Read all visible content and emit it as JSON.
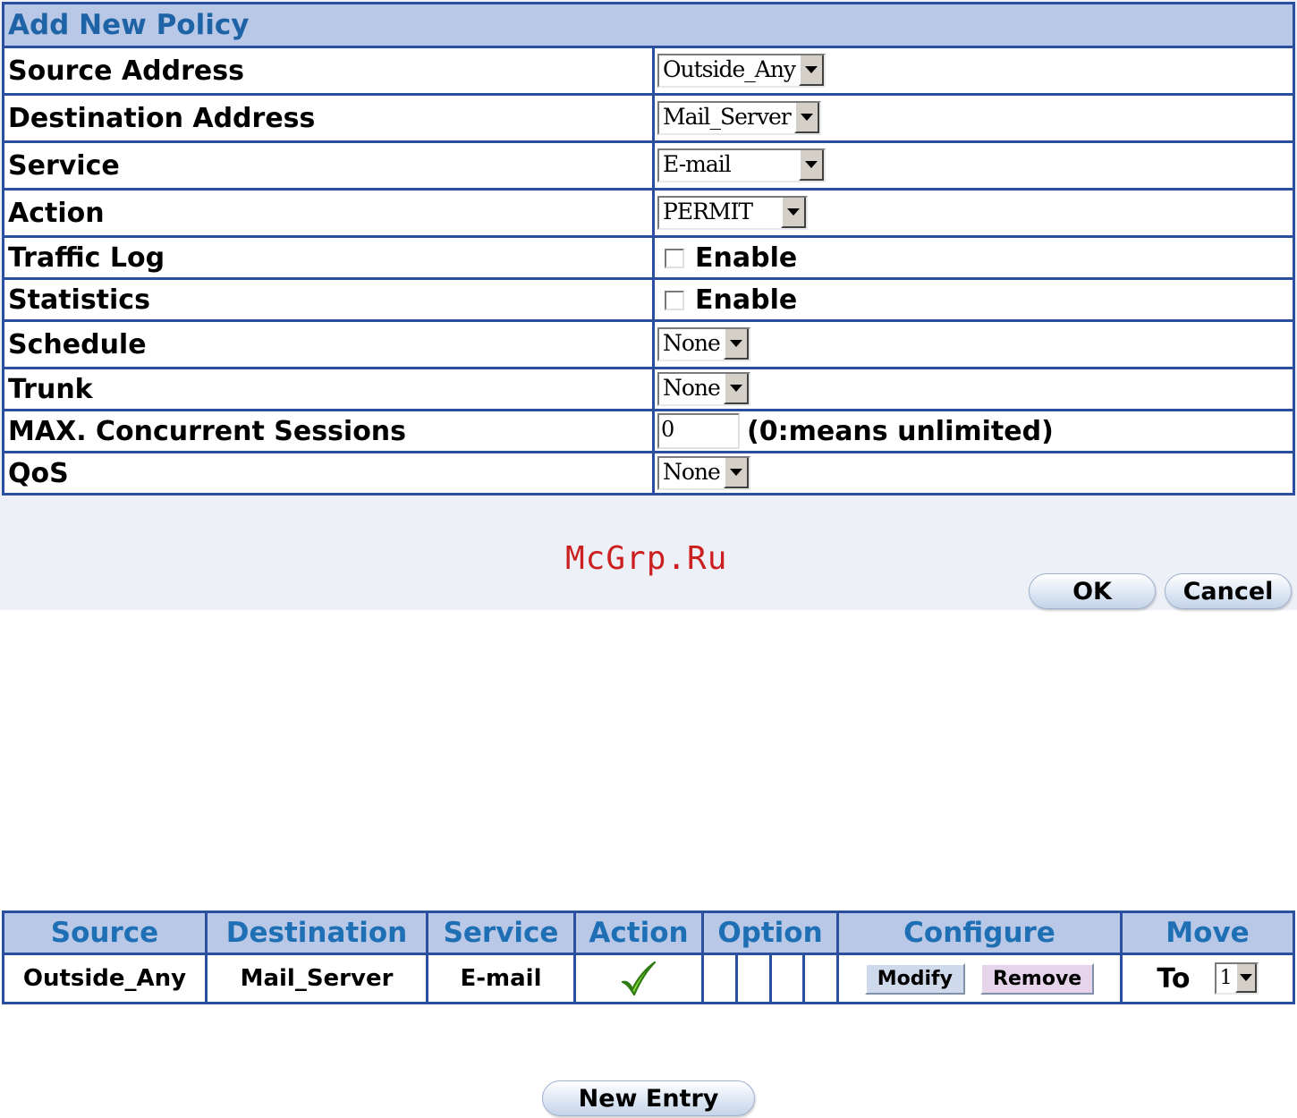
{
  "form": {
    "title": "Add New Policy",
    "fields": {
      "source_address": {
        "label": "Source Address",
        "value": "Outside_Any"
      },
      "destination_address": {
        "label": "Destination Address",
        "value": "Mail_Server"
      },
      "service": {
        "label": "Service",
        "value": "E-mail"
      },
      "action": {
        "label": "Action",
        "value": "PERMIT"
      },
      "traffic_log": {
        "label": "Traffic Log",
        "option": "Enable",
        "checked": false
      },
      "statistics": {
        "label": "Statistics",
        "option": "Enable",
        "checked": false
      },
      "schedule": {
        "label": "Schedule",
        "value": "None"
      },
      "trunk": {
        "label": "Trunk",
        "value": "None"
      },
      "max_sessions": {
        "label": "MAX. Concurrent Sessions",
        "value": "0",
        "hint": "(0:means unlimited)"
      },
      "qos": {
        "label": "QoS",
        "value": "None"
      }
    },
    "ok_label": "OK",
    "cancel_label": "Cancel"
  },
  "watermark": "McGrp.Ru",
  "policy_table": {
    "headers": {
      "source": "Source",
      "destination": "Destination",
      "service": "Service",
      "action": "Action",
      "option": "Option",
      "configure": "Configure",
      "move": "Move"
    },
    "rows": [
      {
        "source": "Outside_Any",
        "destination": "Mail_Server",
        "service": "E-mail",
        "action_icon": "checkmark-icon",
        "modify_label": "Modify",
        "remove_label": "Remove",
        "move_to_label": "To",
        "move_to_value": "1"
      }
    ]
  },
  "new_entry_label": "New Entry",
  "colors": {
    "border": "#2a4f9e",
    "header_bg": "#b8c8e6",
    "header_text": "#1f6fb5",
    "panel_bg": "#edf0f7",
    "watermark": "#cc2020",
    "check_green": "#44b81c"
  }
}
